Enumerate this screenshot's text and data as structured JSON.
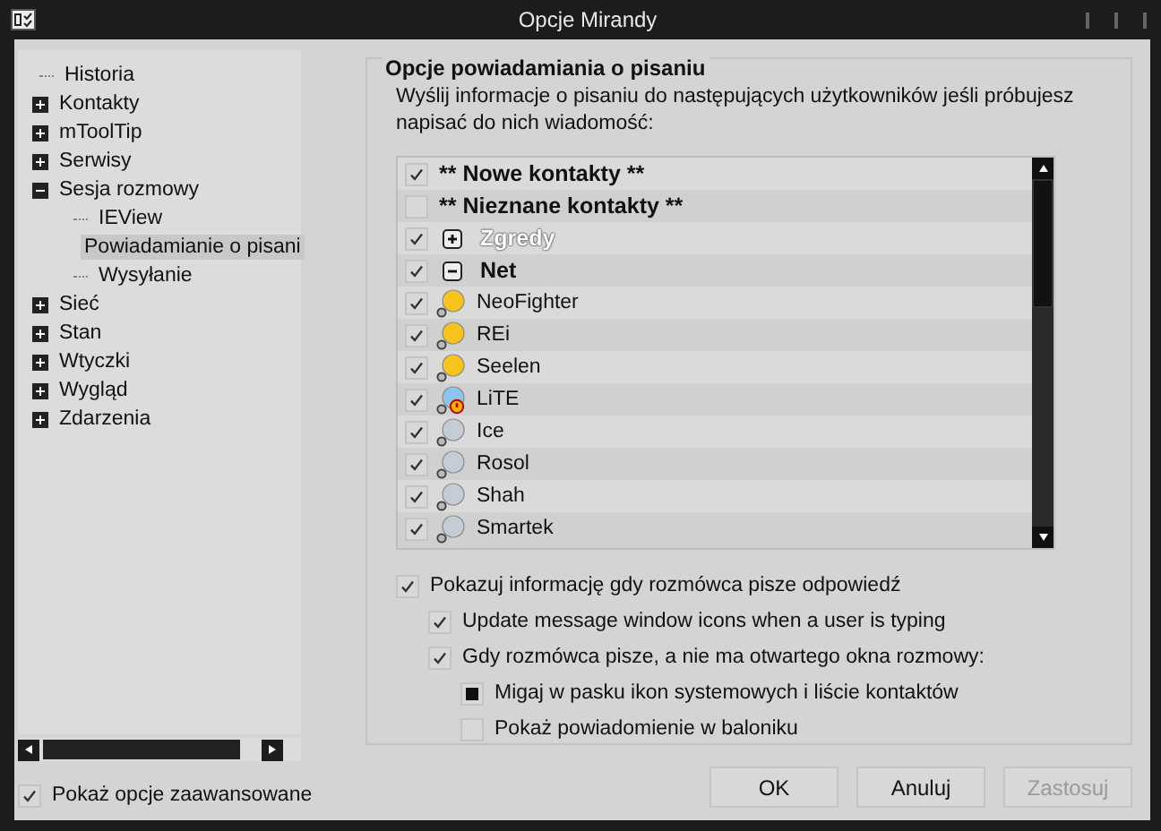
{
  "window": {
    "title": "Opcje Mirandy"
  },
  "tree": [
    {
      "label": "Historia",
      "selected": false
    },
    {
      "label": "Kontakty",
      "expanded": false,
      "selected": false
    },
    {
      "label": "mToolTip",
      "expanded": false,
      "selected": false
    },
    {
      "label": "Serwisy",
      "expanded": false,
      "selected": false
    },
    {
      "label": "Sesja rozmowy",
      "expanded": true,
      "selected": false,
      "children": [
        {
          "label": "IEView",
          "selected": false
        },
        {
          "label": "Powiadamianie o pisani",
          "selected": true
        },
        {
          "label": "Wysyłanie",
          "selected": false
        }
      ]
    },
    {
      "label": "Sieć",
      "expanded": false,
      "selected": false
    },
    {
      "label": "Stan",
      "expanded": false,
      "selected": false
    },
    {
      "label": "Wtyczki",
      "expanded": false,
      "selected": false
    },
    {
      "label": "Wygląd",
      "expanded": false,
      "selected": false
    },
    {
      "label": "Zdarzenia",
      "expanded": false,
      "selected": false
    }
  ],
  "advanced": {
    "label": "Pokaż opcje zaawansowane",
    "checked": true
  },
  "group": {
    "title": "Opcje powiadamiania o pisaniu",
    "description": "Wyślij informacje o pisaniu do następujących użytkowników jeśli próbujesz napisać do nich wiadomość:"
  },
  "contacts": [
    {
      "kind": "special",
      "label": "** Nowe kontakty **",
      "checked": true
    },
    {
      "kind": "special",
      "label": "** Nieznane kontakty **",
      "checked": false
    },
    {
      "kind": "group",
      "label": "Zgredy",
      "checked": true,
      "expanded": false,
      "muted": true
    },
    {
      "kind": "group",
      "label": "Net",
      "checked": true,
      "expanded": true,
      "muted": false
    },
    {
      "kind": "contact",
      "label": "NeoFighter",
      "checked": true,
      "color": "#f7c21c",
      "alert": false
    },
    {
      "kind": "contact",
      "label": "REi",
      "checked": true,
      "color": "#f7c21c",
      "alert": false
    },
    {
      "kind": "contact",
      "label": "Seelen",
      "checked": true,
      "color": "#f7c21c",
      "alert": false
    },
    {
      "kind": "contact",
      "label": "LiTE",
      "checked": true,
      "color": "#8cc4f0",
      "alert": true
    },
    {
      "kind": "contact",
      "label": "Ice",
      "checked": true,
      "color": "#c4ccd6",
      "alert": false
    },
    {
      "kind": "contact",
      "label": "Rosol",
      "checked": true,
      "color": "#c4ccd6",
      "alert": false
    },
    {
      "kind": "contact",
      "label": "Shah",
      "checked": true,
      "color": "#c4ccd6",
      "alert": false
    },
    {
      "kind": "contact",
      "label": "Smartek",
      "checked": true,
      "color": "#c4ccd6",
      "alert": false
    }
  ],
  "options": [
    {
      "kind": "checkbox",
      "label": "Pokazuj informację gdy rozmówca pisze odpowiedź",
      "checked": true,
      "children": [
        {
          "kind": "checkbox",
          "label": "Update message window icons when a user is typing",
          "checked": true
        },
        {
          "kind": "checkbox",
          "label": "Gdy rozmówca pisze, a nie ma otwartego okna rozmowy:",
          "checked": true,
          "children": [
            {
              "kind": "radio",
              "label": "Migaj w pasku ikon systemowych i liście kontaktów",
              "selected": true
            },
            {
              "kind": "radio",
              "label": "Pokaż powiadomienie w baloniku",
              "selected": false
            }
          ]
        }
      ]
    }
  ],
  "buttons": [
    {
      "label": "OK",
      "disabled": false
    },
    {
      "label": "Anuluj",
      "disabled": false
    },
    {
      "label": "Zastosuj",
      "disabled": true
    }
  ]
}
